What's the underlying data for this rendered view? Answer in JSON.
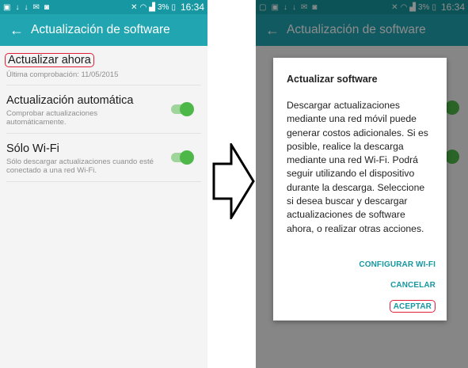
{
  "status_bar": {
    "battery": "3%",
    "time": "16:34"
  },
  "left_screen": {
    "title": "Actualización de software",
    "items": [
      {
        "title": "Actualizar ahora",
        "subtitle": "Última comprobación: 11/05/2015"
      },
      {
        "title": "Actualización automática",
        "subtitle": "Comprobar actualizaciones automáticamente.",
        "enabled": true
      },
      {
        "title": "Sólo Wi-Fi",
        "subtitle": "Sólo descargar actualizaciones cuando esté conectado a una red Wi-Fi.",
        "enabled": true
      }
    ]
  },
  "right_screen": {
    "title": "Actualización de software",
    "dialog": {
      "title": "Actualizar software",
      "message": "Descargar actualizaciones mediante una red móvil puede generar costos adicionales. Si es posible, realice la descarga mediante una red Wi-Fi. Podrá seguir utilizando el dispositivo durante la descarga. Seleccione si desea buscar y descargar actualizaciones de software ahora, o realizar otras acciones.",
      "buttons": {
        "configure_wifi": "CONFIGURAR WI-FI",
        "cancel": "CANCELAR",
        "accept": "ACEPTAR"
      }
    }
  },
  "colors": {
    "app_bar": "#20a5b1",
    "status_bar": "#1797a1",
    "toggle": "#4db848",
    "highlight": "#e0203a",
    "dialog_button": "#1797a1"
  }
}
